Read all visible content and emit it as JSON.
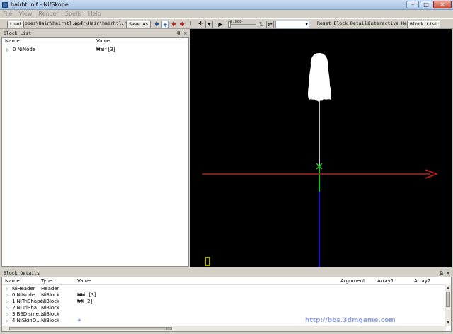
{
  "window": {
    "title": "hairhtl.nif - NifSkope",
    "controls": {
      "minimize": "–",
      "maximize": "□",
      "close": "✕"
    }
  },
  "menu": [
    "File",
    "View",
    "Render",
    "Spells",
    "Help"
  ],
  "toolbar": {
    "load": "Load",
    "load_path": "oper\\Hair\\hairhtl.nif",
    "save_path": "oper\\Hair\\hairhtl.nif",
    "save_as": "Save As",
    "slider_value": "0.000",
    "reset_block_details": "Reset Block Details",
    "interactive_help": "Interactive Help",
    "block_list": "Block List"
  },
  "block_list": {
    "title": "Block List",
    "columns": {
      "name": "Name",
      "value": "Value"
    },
    "rows": [
      {
        "expander": "▷",
        "name": "0 NiNode",
        "type_tag": "txt",
        "value": "Hair [3]"
      }
    ]
  },
  "block_details": {
    "title": "Block Details",
    "columns": {
      "name": "Name",
      "type": "Type",
      "value": "Value",
      "argument": "Argument",
      "array1": "Array1",
      "array2": "Array2"
    },
    "rows": [
      {
        "expander": "▷",
        "name": "NiHeader",
        "type": "Header",
        "tag": "",
        "value": ""
      },
      {
        "expander": "▷",
        "name": "0 NiNode",
        "type": "NiBlock",
        "tag": "txt",
        "value": "Hair [3]"
      },
      {
        "expander": "▷",
        "name": "1 NiTriShape",
        "type": "NiBlock",
        "tag": "txt",
        "value": "htl [2]"
      },
      {
        "expander": "▷",
        "name": "2 NiTriSha...",
        "type": "NiBlock",
        "tag": "",
        "value": ""
      },
      {
        "expander": "▷",
        "name": "3 BSDisme...",
        "type": "NiBlock",
        "tag": "",
        "value": ""
      },
      {
        "expander": "▷",
        "name": "4 NiSkinD...",
        "type": "NiBlock",
        "tag": "",
        "value": ""
      }
    ]
  },
  "viewport": {
    "axis_colors": {
      "x": "#d01818",
      "y": "#20c020",
      "z": "#1818d0"
    },
    "model_color": "#ffffff",
    "marker_color": "#e6e600"
  },
  "watermark": "http://bbs.3dmgame.com"
}
